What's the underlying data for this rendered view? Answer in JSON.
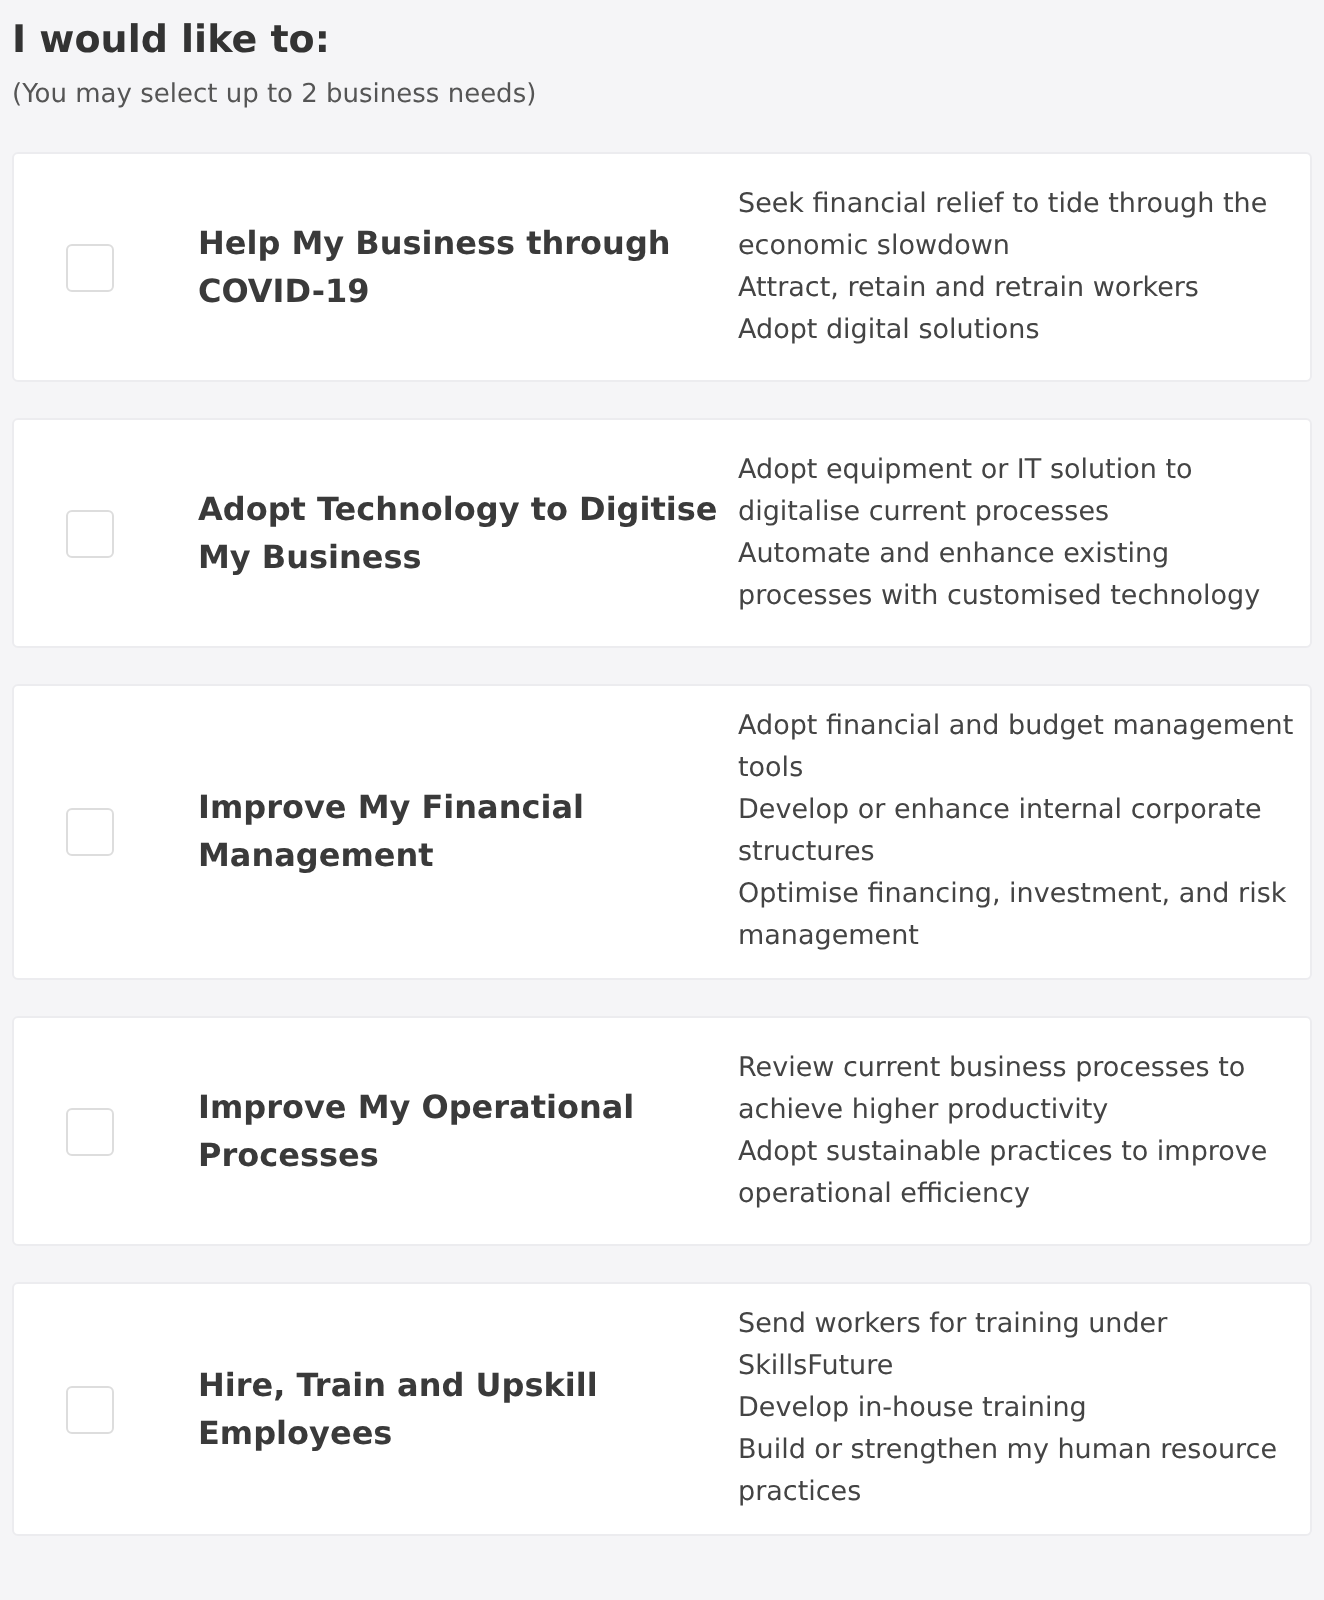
{
  "heading": "I would like to:",
  "subheading": "(You may select up to 2 business needs)",
  "needs": [
    {
      "title": "Help My Business through COVID-19",
      "checked": false,
      "benefits": [
        "Seek financial relief to tide through the economic slowdown",
        "Attract, retain and retrain workers",
        "Adopt digital solutions"
      ]
    },
    {
      "title": "Adopt Technology to Digitise My Business",
      "checked": false,
      "benefits": [
        "Adopt equipment or IT solution to digitalise current processes",
        "Automate and enhance existing processes with customised technology"
      ]
    },
    {
      "title": "Improve My Financial Management",
      "checked": false,
      "benefits": [
        "Adopt financial and budget management tools",
        "Develop or enhance internal corporate structures",
        "Optimise financing, investment, and risk management"
      ]
    },
    {
      "title": "Improve My Operational Processes",
      "checked": false,
      "benefits": [
        "Review current business processes to achieve higher productivity",
        "Adopt sustainable practices to improve operational efficiency"
      ]
    },
    {
      "title": "Hire, Train and Upskill Employees",
      "checked": false,
      "benefits": [
        "Send workers for training under SkillsFuture",
        "Develop in-house training",
        "Build or strengthen my human resource practices"
      ]
    }
  ]
}
